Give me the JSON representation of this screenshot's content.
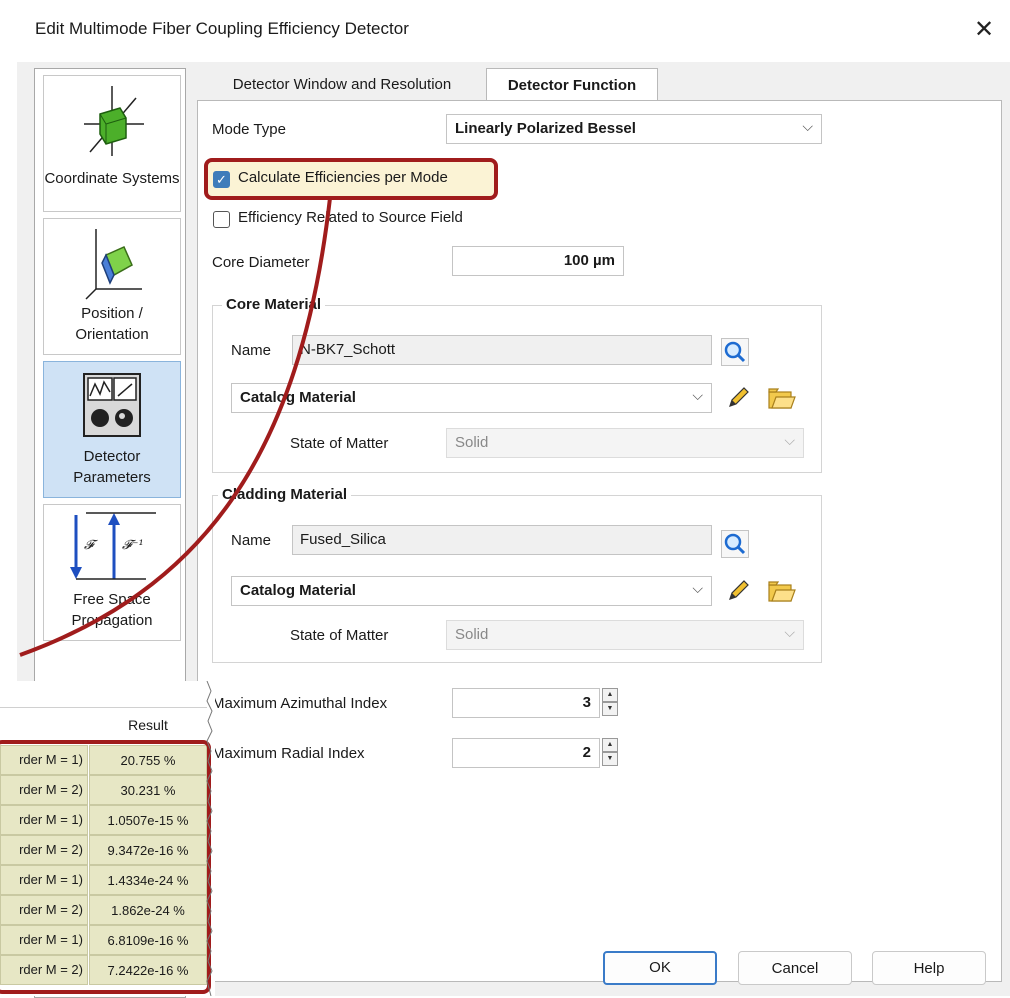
{
  "window": {
    "title": "Edit Multimode Fiber Coupling Efficiency Detector"
  },
  "nav": [
    {
      "label": "Coordinate Systems",
      "icon": "coordinate-systems-icon"
    },
    {
      "label": "Position / Orientation",
      "icon": "position-orientation-icon"
    },
    {
      "label": "Detector Parameters",
      "icon": "detector-parameters-icon"
    },
    {
      "label": "Free Space Propagation",
      "icon": "fourier-transform-icon"
    }
  ],
  "tabs": [
    "Detector Window and Resolution",
    "Detector Function"
  ],
  "form": {
    "mode_type_label": "Mode Type",
    "mode_type_value": "Linearly Polarized Bessel",
    "calc_per_mode_label": "Calculate Efficiencies per Mode",
    "calc_per_mode_checked": true,
    "related_to_source_label": "Efficiency Related to Source Field",
    "related_to_source_checked": false,
    "core_diameter_label": "Core Diameter",
    "core_diameter_value": "100 µm",
    "core": {
      "group_title": "Core Material",
      "name_label": "Name",
      "name_value": "N-BK7_Schott",
      "catalog": "Catalog Material",
      "state_label": "State of Matter",
      "state_value": "Solid"
    },
    "cladding": {
      "group_title": "Cladding Material",
      "name_label": "Name",
      "name_value": "Fused_Silica",
      "catalog": "Catalog Material",
      "state_label": "State of Matter",
      "state_value": "Solid"
    },
    "max_azimuthal_label": "Maximum Azimuthal Index",
    "max_azimuthal_value": "3",
    "max_radial_label": "Maximum Radial Index",
    "max_radial_value": "2"
  },
  "buttons": {
    "ok": "OK",
    "cancel": "Cancel",
    "help": "Help"
  },
  "results": {
    "header": "Result",
    "rows": [
      {
        "label": "rder M = 1)",
        "value": "20.755 %"
      },
      {
        "label": "rder M = 2)",
        "value": "30.231 %"
      },
      {
        "label": "rder M = 1)",
        "value": "1.0507e-15 %"
      },
      {
        "label": "rder M = 2)",
        "value": "9.3472e-16 %"
      },
      {
        "label": "rder M = 1)",
        "value": "1.4334e-24 %"
      },
      {
        "label": "rder M = 2)",
        "value": "1.862e-24 %"
      },
      {
        "label": "rder M = 1)",
        "value": "6.8109e-16 %"
      },
      {
        "label": "rder M = 2)",
        "value": "7.2422e-16 %"
      }
    ]
  },
  "colors": {
    "highlight": "#a01c1c",
    "selected_nav": "#cfe2f5",
    "result_cell": "#e7e7c5",
    "check_accent": "#3e7cba"
  }
}
